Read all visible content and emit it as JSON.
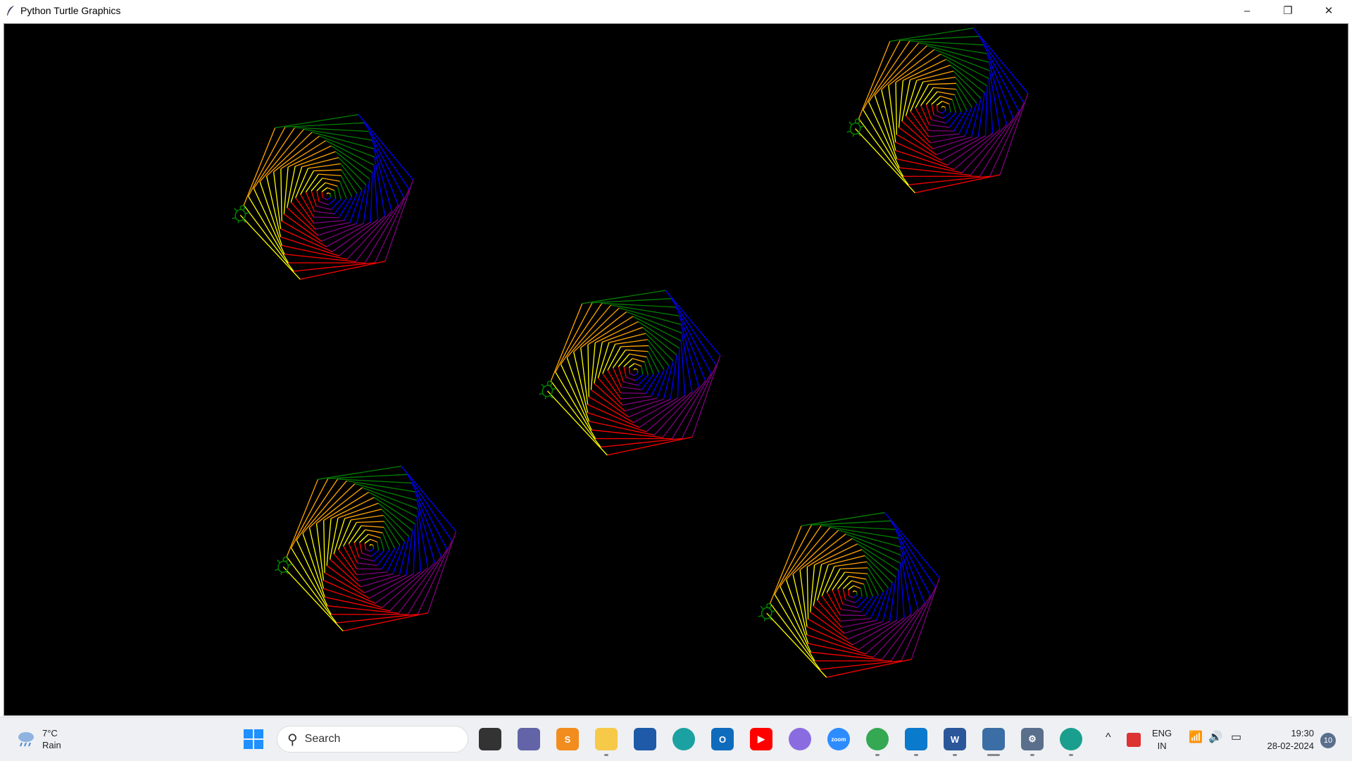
{
  "window": {
    "title": "Python Turtle Graphics",
    "minimize": "–",
    "restore": "❐",
    "close": "✕"
  },
  "canvas": {
    "background": "#000000",
    "pen_colors": [
      "#ff0000",
      "#ffff00",
      "#ffa500",
      "#008000",
      "#0000ff",
      "#800080"
    ],
    "turtle_color": "#008000",
    "spiral_count": 5
  },
  "taskbar": {
    "weather": {
      "temp": "7°C",
      "condition": "Rain"
    },
    "search_placeholder": "Search",
    "apps": [
      {
        "name": "task-view",
        "label": "",
        "color": "#333333"
      },
      {
        "name": "teams",
        "label": "",
        "color": "#6264a7"
      },
      {
        "name": "sublime-text",
        "label": "S",
        "color": "#f28c1e"
      },
      {
        "name": "file-explorer",
        "label": "",
        "color": "#f7c948"
      },
      {
        "name": "microsoft-store",
        "label": "",
        "color": "#1e5aa8"
      },
      {
        "name": "edge",
        "label": "",
        "color": "#1ba1a1"
      },
      {
        "name": "outlook",
        "label": "O",
        "color": "#0f6cbd"
      },
      {
        "name": "youtube",
        "label": "▶",
        "color": "#ff0000"
      },
      {
        "name": "copilot",
        "label": "",
        "color": "#8a6ce0"
      },
      {
        "name": "zoom",
        "label": "zoom",
        "color": "#2d8cff"
      },
      {
        "name": "chrome",
        "label": "",
        "color": "#34a853"
      },
      {
        "name": "vscode",
        "label": "",
        "color": "#0a7acc"
      },
      {
        "name": "word",
        "label": "W",
        "color": "#2b579a"
      },
      {
        "name": "python-turtle",
        "label": "",
        "color": "#3b6ea5"
      },
      {
        "name": "settings",
        "label": "⚙",
        "color": "#5a6f8c"
      },
      {
        "name": "edge-beta",
        "label": "",
        "color": "#1a9f8e"
      }
    ],
    "tray": {
      "chevron": "^",
      "lang_top": "ENG",
      "lang_bottom": "IN",
      "time": "19:30",
      "date": "28-02-2024",
      "notifications": "10"
    }
  }
}
